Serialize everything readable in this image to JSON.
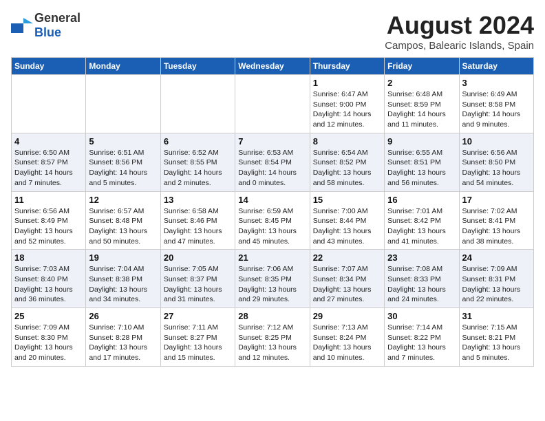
{
  "header": {
    "logo_general": "General",
    "logo_blue": "Blue",
    "month_title": "August 2024",
    "location": "Campos, Balearic Islands, Spain"
  },
  "days_of_week": [
    "Sunday",
    "Monday",
    "Tuesday",
    "Wednesday",
    "Thursday",
    "Friday",
    "Saturday"
  ],
  "weeks": [
    [
      {
        "day": "",
        "info": ""
      },
      {
        "day": "",
        "info": ""
      },
      {
        "day": "",
        "info": ""
      },
      {
        "day": "",
        "info": ""
      },
      {
        "day": "1",
        "info": "Sunrise: 6:47 AM\nSunset: 9:00 PM\nDaylight: 14 hours\nand 12 minutes."
      },
      {
        "day": "2",
        "info": "Sunrise: 6:48 AM\nSunset: 8:59 PM\nDaylight: 14 hours\nand 11 minutes."
      },
      {
        "day": "3",
        "info": "Sunrise: 6:49 AM\nSunset: 8:58 PM\nDaylight: 14 hours\nand 9 minutes."
      }
    ],
    [
      {
        "day": "4",
        "info": "Sunrise: 6:50 AM\nSunset: 8:57 PM\nDaylight: 14 hours\nand 7 minutes."
      },
      {
        "day": "5",
        "info": "Sunrise: 6:51 AM\nSunset: 8:56 PM\nDaylight: 14 hours\nand 5 minutes."
      },
      {
        "day": "6",
        "info": "Sunrise: 6:52 AM\nSunset: 8:55 PM\nDaylight: 14 hours\nand 2 minutes."
      },
      {
        "day": "7",
        "info": "Sunrise: 6:53 AM\nSunset: 8:54 PM\nDaylight: 14 hours\nand 0 minutes."
      },
      {
        "day": "8",
        "info": "Sunrise: 6:54 AM\nSunset: 8:52 PM\nDaylight: 13 hours\nand 58 minutes."
      },
      {
        "day": "9",
        "info": "Sunrise: 6:55 AM\nSunset: 8:51 PM\nDaylight: 13 hours\nand 56 minutes."
      },
      {
        "day": "10",
        "info": "Sunrise: 6:56 AM\nSunset: 8:50 PM\nDaylight: 13 hours\nand 54 minutes."
      }
    ],
    [
      {
        "day": "11",
        "info": "Sunrise: 6:56 AM\nSunset: 8:49 PM\nDaylight: 13 hours\nand 52 minutes."
      },
      {
        "day": "12",
        "info": "Sunrise: 6:57 AM\nSunset: 8:48 PM\nDaylight: 13 hours\nand 50 minutes."
      },
      {
        "day": "13",
        "info": "Sunrise: 6:58 AM\nSunset: 8:46 PM\nDaylight: 13 hours\nand 47 minutes."
      },
      {
        "day": "14",
        "info": "Sunrise: 6:59 AM\nSunset: 8:45 PM\nDaylight: 13 hours\nand 45 minutes."
      },
      {
        "day": "15",
        "info": "Sunrise: 7:00 AM\nSunset: 8:44 PM\nDaylight: 13 hours\nand 43 minutes."
      },
      {
        "day": "16",
        "info": "Sunrise: 7:01 AM\nSunset: 8:42 PM\nDaylight: 13 hours\nand 41 minutes."
      },
      {
        "day": "17",
        "info": "Sunrise: 7:02 AM\nSunset: 8:41 PM\nDaylight: 13 hours\nand 38 minutes."
      }
    ],
    [
      {
        "day": "18",
        "info": "Sunrise: 7:03 AM\nSunset: 8:40 PM\nDaylight: 13 hours\nand 36 minutes."
      },
      {
        "day": "19",
        "info": "Sunrise: 7:04 AM\nSunset: 8:38 PM\nDaylight: 13 hours\nand 34 minutes."
      },
      {
        "day": "20",
        "info": "Sunrise: 7:05 AM\nSunset: 8:37 PM\nDaylight: 13 hours\nand 31 minutes."
      },
      {
        "day": "21",
        "info": "Sunrise: 7:06 AM\nSunset: 8:35 PM\nDaylight: 13 hours\nand 29 minutes."
      },
      {
        "day": "22",
        "info": "Sunrise: 7:07 AM\nSunset: 8:34 PM\nDaylight: 13 hours\nand 27 minutes."
      },
      {
        "day": "23",
        "info": "Sunrise: 7:08 AM\nSunset: 8:33 PM\nDaylight: 13 hours\nand 24 minutes."
      },
      {
        "day": "24",
        "info": "Sunrise: 7:09 AM\nSunset: 8:31 PM\nDaylight: 13 hours\nand 22 minutes."
      }
    ],
    [
      {
        "day": "25",
        "info": "Sunrise: 7:09 AM\nSunset: 8:30 PM\nDaylight: 13 hours\nand 20 minutes."
      },
      {
        "day": "26",
        "info": "Sunrise: 7:10 AM\nSunset: 8:28 PM\nDaylight: 13 hours\nand 17 minutes."
      },
      {
        "day": "27",
        "info": "Sunrise: 7:11 AM\nSunset: 8:27 PM\nDaylight: 13 hours\nand 15 minutes."
      },
      {
        "day": "28",
        "info": "Sunrise: 7:12 AM\nSunset: 8:25 PM\nDaylight: 13 hours\nand 12 minutes."
      },
      {
        "day": "29",
        "info": "Sunrise: 7:13 AM\nSunset: 8:24 PM\nDaylight: 13 hours\nand 10 minutes."
      },
      {
        "day": "30",
        "info": "Sunrise: 7:14 AM\nSunset: 8:22 PM\nDaylight: 13 hours\nand 7 minutes."
      },
      {
        "day": "31",
        "info": "Sunrise: 7:15 AM\nSunset: 8:21 PM\nDaylight: 13 hours\nand 5 minutes."
      }
    ]
  ]
}
